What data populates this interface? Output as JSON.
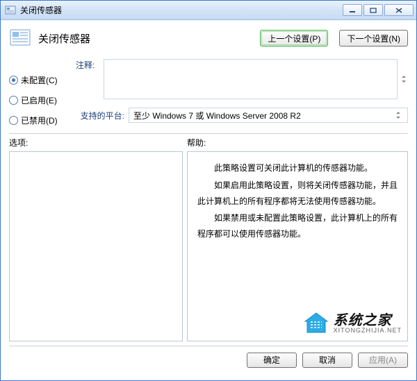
{
  "titlebar": {
    "title": "关闭传感器"
  },
  "header": {
    "title": "关闭传感器",
    "prev_btn": "上一个设置(P)",
    "next_btn": "下一个设置(N)"
  },
  "radios": {
    "not_configured": "未配置(C)",
    "enabled": "已启用(E)",
    "disabled": "已禁用(D)",
    "selected": "not_configured"
  },
  "comment": {
    "label": "注释:",
    "value": ""
  },
  "support": {
    "label": "支持的平台:",
    "value": "至少 Windows 7 或 Windows Server 2008 R2"
  },
  "lower": {
    "options_label": "选项:",
    "help_label": "帮助:",
    "help_paragraphs": [
      "此策略设置可关闭此计算机的传感器功能。",
      "如果启用此策略设置，则将关闭传感器功能，并且此计算机上的所有程序都将无法使用传感器功能。",
      "如果禁用或未配置此策略设置，此计算机上的所有程序都可以使用传感器功能。"
    ]
  },
  "buttons": {
    "ok": "确定",
    "cancel": "取消",
    "apply": "应用(A)"
  },
  "watermark": {
    "big": "系统之家",
    "small": "XITONGZHIJIA.NET"
  }
}
